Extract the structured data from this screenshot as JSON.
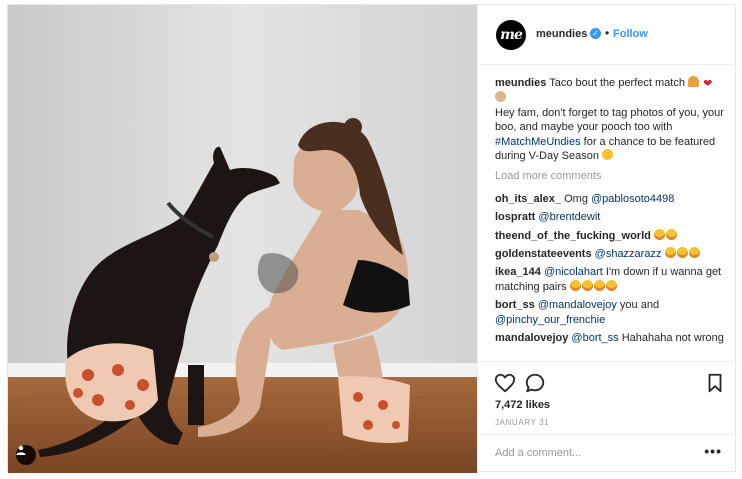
{
  "header": {
    "avatar_text": "me",
    "username": "meundies",
    "separator": "•",
    "follow_label": "Follow"
  },
  "caption": {
    "username": "meundies",
    "line1": "Taco bout the perfect match",
    "text_pre": "Hey fam, don't forget to tag photos of you, your boo, and maybe your pooch too with",
    "hashtag": "#MatchMeUndies",
    "text_post": "for a chance to be featured during V-Day Season"
  },
  "load_more_label": "Load more comments",
  "comments": [
    {
      "username": "oh_its_alex_",
      "text_pre": "Omg",
      "mention": "@pablosoto4498",
      "text_post": ""
    },
    {
      "username": "lospratt",
      "text_pre": "",
      "mention": "@brentdewit",
      "text_post": ""
    },
    {
      "username": "theend_of_the_fucking_world",
      "text_pre": "",
      "mention": "",
      "text_post": ""
    },
    {
      "username": "goldenstateevents",
      "text_pre": "",
      "mention": "@shazzarazz",
      "text_post": ""
    },
    {
      "username": "ikea_144",
      "text_pre": "",
      "mention": "@nicolahart",
      "text_post": "I'm down if u wanna get matching pairs"
    },
    {
      "username": "bort_ss",
      "text_pre": "",
      "mention": "@mandalovejoy",
      "text_post": "you and",
      "mention2": "@pinchy_our_frenchie"
    },
    {
      "username": "mandalovejoy",
      "text_pre": "",
      "mention": "@bort_ss",
      "text_post": "Hahahaha not wrong"
    }
  ],
  "likes": "7,472 likes",
  "date": "JANUARY 31",
  "add_comment_placeholder": "Add a comment...",
  "more_label": "•••",
  "icons": {
    "heart": "heart-icon",
    "comment": "comment-icon",
    "save": "bookmark-icon",
    "verified": "verified-badge-icon",
    "tag": "user-tag-icon"
  },
  "colors": {
    "link": "#003569",
    "follow": "#3897f0",
    "muted": "#999999"
  }
}
